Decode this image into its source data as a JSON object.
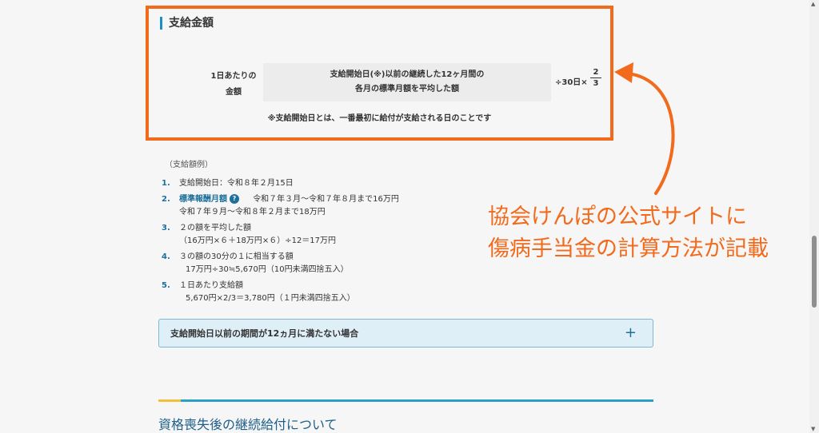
{
  "section": {
    "heading": "支給金額",
    "per_day_line1": "1日あたりの",
    "per_day_line2": "金額",
    "formula_line1": "支給開始日(※)以前の継続した12ヶ月間の",
    "formula_line2": "各月の標準月額を平均した額",
    "divisor": "÷30日×",
    "fraction_num": "2",
    "fraction_den": "3",
    "note": "※支給開始日とは、一番最初に給付が支給される日のことです"
  },
  "example": {
    "label": "（支給額例）",
    "steps": [
      {
        "num": "1.",
        "line1": "支給開始日：令和８年２月15日"
      },
      {
        "num": "2.",
        "term": "標準報酬月額",
        "line1": "令和７年３月〜令和７年８月まで16万円",
        "line2": "令和７年９月〜令和８年２月まで18万円"
      },
      {
        "num": "3.",
        "line1": "２の額を平均した額",
        "line2": "（16万円×６＋18万円×６）÷12＝17万円"
      },
      {
        "num": "4.",
        "line1": "３の額の30分の１に相当する額",
        "line2": "17万円÷30≒5,670円（10円未満四捨五入）"
      },
      {
        "num": "5.",
        "line1": "１日あたり支給額",
        "line2": "5,670円×2/3＝3,780円（１円未満四捨五入）"
      }
    ],
    "help_mark": "?"
  },
  "accordion": {
    "title": "支給開始日以前の期間が12ヵ月に満たない場合",
    "plus": "+"
  },
  "bottom": {
    "heading": "資格喪失後の継続給付について"
  },
  "annotation": {
    "line1": "協会けんぽの公式サイトに",
    "line2": "傷病手当金の計算方法が記載"
  },
  "colors": {
    "highlight": "#f26a1b",
    "accent_blue": "#1d6f9c",
    "accordion_bg": "#dfeff8"
  }
}
